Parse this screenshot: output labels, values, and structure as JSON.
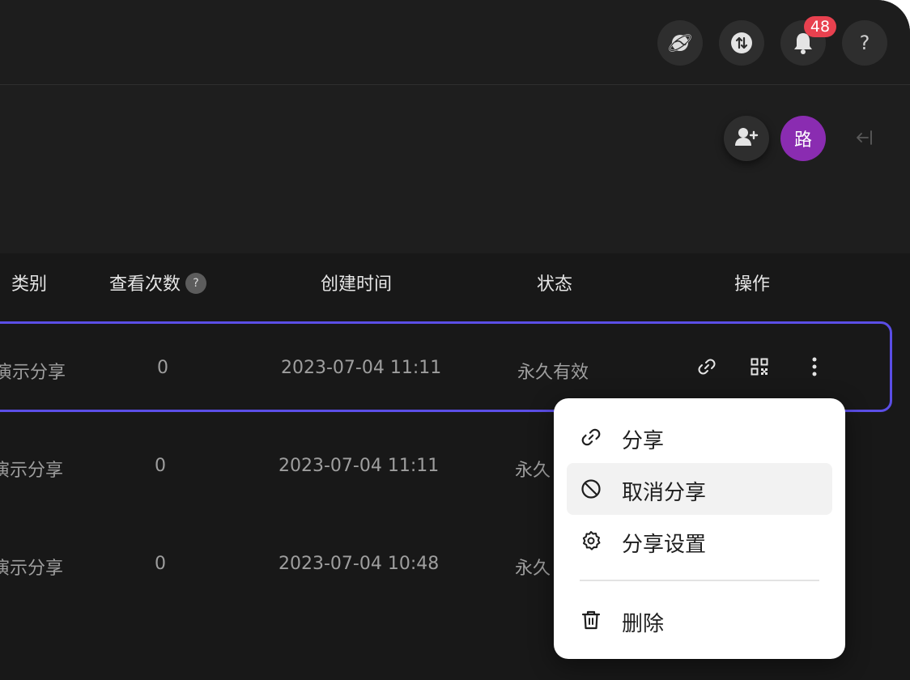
{
  "topbar": {
    "notifications_count": "48",
    "help_label": "?"
  },
  "subheader": {
    "avatar_initial": "路"
  },
  "table": {
    "columns": [
      "类别",
      "查看次数",
      "创建时间",
      "状态",
      "操作"
    ],
    "help_mark": "?",
    "rows": [
      {
        "category": "演示分享",
        "views": "0",
        "created": "2023-07-04 11:11",
        "status": "永久有效"
      },
      {
        "category": "演示分享",
        "views": "0",
        "created": "2023-07-04 11:11",
        "status": "永久"
      },
      {
        "category": "演示分享",
        "views": "0",
        "created": "2023-07-04 10:48",
        "status": "永久"
      }
    ]
  },
  "menu": {
    "items": [
      {
        "label": "分享",
        "icon": "link-icon"
      },
      {
        "label": "取消分享",
        "icon": "ban-icon"
      },
      {
        "label": "分享设置",
        "icon": "gear-icon"
      },
      {
        "label": "删除",
        "icon": "trash-icon"
      }
    ]
  },
  "colors": {
    "accent": "#5b4ee6",
    "badge": "#e8414f",
    "avatar": "#8a2cb1",
    "background": "#181818"
  }
}
